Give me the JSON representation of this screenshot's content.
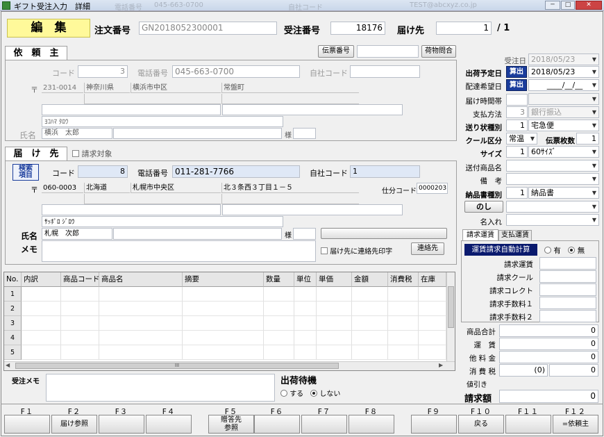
{
  "window": {
    "title": "ギフト受注入力　詳細",
    "ghost1": "電話番号",
    "ghost2": "045-663-0700",
    "ghost3": "自社コード",
    "ghost4": "TEST@abcxyz.co.jp"
  },
  "header": {
    "mode": "編　集",
    "order_no_label": "注文番号",
    "order_no": "GN2018052300001",
    "recv_no_label": "受注番号",
    "recv_no": "18176",
    "dest_label": "届け先",
    "dest_page": "1",
    "dest_total": "/ 1"
  },
  "requester": {
    "tab": "依　頼　主",
    "denpyo_btn": "伝票番号",
    "denpyo_value": "",
    "nimotsu_btn": "荷物問合",
    "code_label": "コード",
    "code": "3",
    "tel_label": "電話番号",
    "tel": "045-663-0700",
    "own_code_label": "自社コード",
    "own_code": "",
    "zip_mark": "〒",
    "zip": "231-0014",
    "pref": "神奈川県",
    "city": "横浜市中区",
    "addr": "常盤町",
    "kana": "ﾖｺﾊﾏ ﾀﾛｳ",
    "name_label": "氏名",
    "name": "横浜　太郎",
    "sama": "様"
  },
  "destination": {
    "tab": "届　け　先",
    "bill_target": "請求対象",
    "search_btn": "検索\n項目",
    "code_label": "コード",
    "code": "8",
    "tel_label": "電話番号",
    "tel": "011-281-7766",
    "own_code_label": "自社コード",
    "own_code": "1",
    "zip_mark": "〒",
    "zip": "060-0003",
    "pref": "北海道",
    "city": "札幌市中央区",
    "addr": "北３条西３丁目１－５",
    "shiwake_label": "仕分コード",
    "shiwake": "0000203",
    "kana": "ｻｯﾎﾟﾛ ｼﾞﾛｳ",
    "name_label": "氏名",
    "name": "札幌　次郎",
    "sama": "様",
    "memo_label": "メモ",
    "print_contact": "届け先に連絡先印字",
    "contact_btn": "連絡先"
  },
  "order_info": {
    "order_date_label": "受注日",
    "order_date": "2018/05/23",
    "ship_date_label": "出荷予定日",
    "calc": "算出",
    "ship_date": "2018/05/23",
    "wish_date_label": "配達希望日",
    "wish_date": "____/__/__",
    "time_label": "届け時間帯",
    "time": "",
    "pay_label": "支払方法",
    "pay_code": "3",
    "pay": "銀行振込",
    "slip_label": "送り状種別",
    "slip_code": "1",
    "slip": "宅急便",
    "cool_label": "クール区分",
    "cool": "常温",
    "slip_count_label": "伝票枚数",
    "slip_count": "1",
    "size_label": "サイズ",
    "size_code": "1",
    "size": "60ｻｲｽﾞ",
    "goods_label": "送付商品名",
    "goods": "",
    "note_label": "備　考",
    "note": "",
    "delivnote_label": "納品書種別",
    "delivnote_code": "1",
    "delivnote": "納品書",
    "noshi_btn": "のし",
    "noshi": "",
    "name_in_label": "名入れ",
    "name_in": ""
  },
  "shipping_tabs": {
    "tab1": "請求運賃",
    "tab2": "支払運賃",
    "auto_calc": "運賃請求自動計算",
    "opt_yes": "有",
    "opt_no": "無",
    "rows": [
      {
        "label": "請求運賃",
        "value": ""
      },
      {
        "label": "請求クール",
        "value": ""
      },
      {
        "label": "請求コレクト",
        "value": ""
      },
      {
        "label": "請求手数料１",
        "value": ""
      },
      {
        "label": "請求手数料２",
        "value": ""
      }
    ]
  },
  "totals": {
    "goods_total_label": "商品合計",
    "goods_total": "0",
    "freight_label": "運　賃",
    "freight": "0",
    "other_label": "他 料 金",
    "other": "0",
    "tax_label": "消 費 税",
    "tax_code": "(0)",
    "tax": "0",
    "discount_label": "値引き",
    "discount": "",
    "bill_label": "請求額",
    "bill": "0"
  },
  "grid": {
    "headers": [
      "No.",
      "内訳",
      "商品コード",
      "商品名",
      "摘要",
      "数量",
      "単位",
      "単価",
      "金額",
      "消費税",
      "在庫"
    ],
    "rows": [
      "1",
      "2",
      "3",
      "4",
      "5"
    ],
    "scroll_mark": "III"
  },
  "bottom": {
    "memo_label": "受注メモ",
    "memo": "",
    "wait_label": "出荷待機",
    "wait_yes": "する",
    "wait_no": "しない"
  },
  "fkeys": [
    {
      "key": "F１",
      "label": ""
    },
    {
      "key": "F２",
      "label": "届け参照"
    },
    {
      "key": "F３",
      "label": ""
    },
    {
      "key": "F４",
      "label": ""
    },
    {
      "key": "F５",
      "label": "贈答先\n参照"
    },
    {
      "key": "F６",
      "label": ""
    },
    {
      "key": "F７",
      "label": ""
    },
    {
      "key": "F８",
      "label": ""
    },
    {
      "key": "F９",
      "label": ""
    },
    {
      "key": "F１０",
      "label": "戻る"
    },
    {
      "key": "F１１",
      "label": ""
    },
    {
      "key": "F１２",
      "label": "=依頼主"
    }
  ],
  "colors": {
    "mode_bg": "#fff99a",
    "accent": "#1b3d9c"
  }
}
